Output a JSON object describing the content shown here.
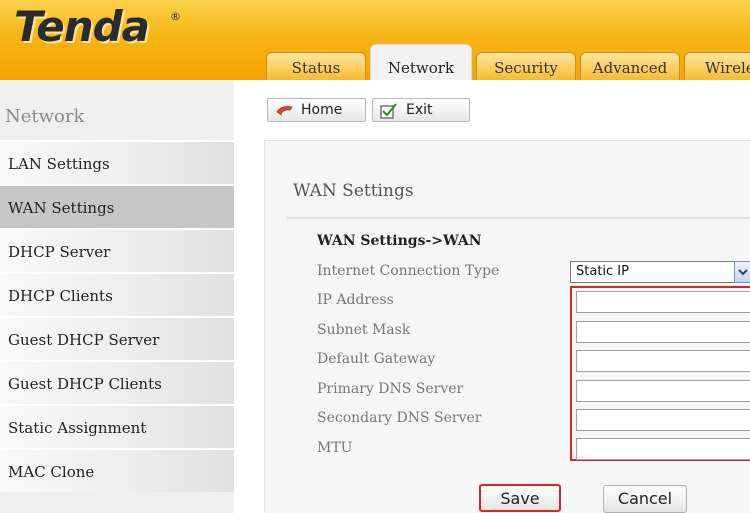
{
  "brand": {
    "logo": "Tenda",
    "reg_mark": "®"
  },
  "tabs": [
    {
      "label": "Status"
    },
    {
      "label": "Network"
    },
    {
      "label": "Security"
    },
    {
      "label": "Advanced"
    },
    {
      "label": "Wirele"
    }
  ],
  "sidebar": {
    "title": "Network",
    "items": [
      {
        "label": "LAN Settings"
      },
      {
        "label": "WAN Settings"
      },
      {
        "label": "DHCP Server"
      },
      {
        "label": "DHCP Clients"
      },
      {
        "label": "Guest DHCP Server"
      },
      {
        "label": "Guest DHCP Clients"
      },
      {
        "label": "Static Assignment"
      },
      {
        "label": "MAC Clone"
      }
    ]
  },
  "toolbar": {
    "home_label": "Home",
    "exit_label": "Exit"
  },
  "panel": {
    "title": "WAN Settings",
    "heading": "WAN Settings->WAN",
    "labels": {
      "connection_type": "Internet Connection Type",
      "ip_address": "IP Address",
      "subnet_mask": "Subnet Mask",
      "default_gateway": "Default Gateway",
      "primary_dns": "Primary DNS Server",
      "secondary_dns": "Secondary DNS Server",
      "mtu": "MTU"
    },
    "connection_type_value": "Static IP",
    "values": {
      "ip_address": "",
      "subnet_mask": "",
      "default_gateway": "",
      "primary_dns": "",
      "secondary_dns": "",
      "mtu": ""
    },
    "save_label": "Save",
    "cancel_label": "Cancel"
  },
  "colors": {
    "header_gold": "#f7b615",
    "highlight_red": "#d9262b",
    "active_side": "#c6c6c6"
  },
  "icons": {
    "home": "home-arrow-icon",
    "exit": "checkbox-exit-icon",
    "select": "chevron-down-icon"
  }
}
